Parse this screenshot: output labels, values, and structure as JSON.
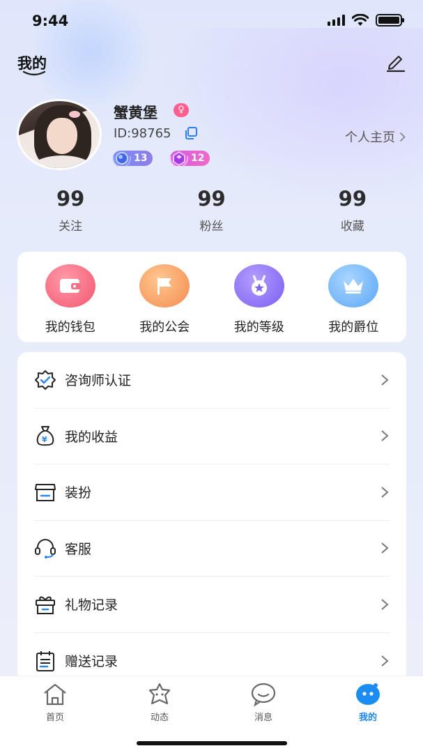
{
  "status_bar": {
    "time": "9:44"
  },
  "header": {
    "title": "我的"
  },
  "profile": {
    "nickname": "蟹黄堡",
    "gender_symbol": "♀",
    "user_id": "ID:98765",
    "profile_link": "个人主页",
    "badges": [
      {
        "value": "13"
      },
      {
        "value": "12"
      }
    ]
  },
  "stats": [
    {
      "value": "99",
      "label": "关注"
    },
    {
      "value": "99",
      "label": "粉丝"
    },
    {
      "value": "99",
      "label": "收藏"
    }
  ],
  "quick_actions": [
    {
      "label": "我的钱包",
      "icon": "wallet-icon"
    },
    {
      "label": "我的公会",
      "icon": "flag-icon"
    },
    {
      "label": "我的等级",
      "icon": "medal-icon"
    },
    {
      "label": "我的爵位",
      "icon": "crown-icon"
    }
  ],
  "menu": [
    {
      "label": "咨询师认证",
      "icon": "certified-badge-icon"
    },
    {
      "label": "我的收益",
      "icon": "money-bag-icon"
    },
    {
      "label": "装扮",
      "icon": "shop-icon"
    },
    {
      "label": "客服",
      "icon": "headset-icon"
    },
    {
      "label": "礼物记录",
      "icon": "gift-icon"
    },
    {
      "label": "赠送记录",
      "icon": "calendar-list-icon"
    }
  ],
  "tabs": [
    {
      "label": "首页",
      "icon": "home-icon",
      "active": false
    },
    {
      "label": "动态",
      "icon": "star-face-icon",
      "active": false
    },
    {
      "label": "消息",
      "icon": "chat-bubble-icon",
      "active": false
    },
    {
      "label": "我的",
      "icon": "profile-bubble-icon",
      "active": true
    }
  ],
  "colors": {
    "accent": "#1a86f0",
    "gender": "#ff5f8f",
    "background": "#e6ebfb"
  }
}
